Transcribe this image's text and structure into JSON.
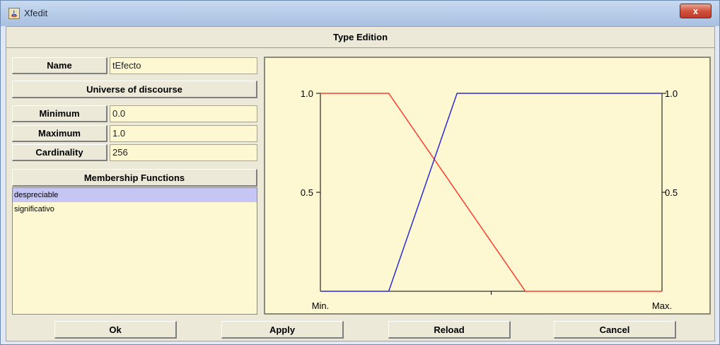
{
  "window": {
    "title": "Xfedit",
    "close_label": "x"
  },
  "header": {
    "title": "Type Edition"
  },
  "form": {
    "name_label": "Name",
    "name_value": "tEfecto",
    "universe_label": "Universe of discourse",
    "minimum_label": "Minimum",
    "minimum_value": "0.0",
    "maximum_label": "Maximum",
    "maximum_value": "1.0",
    "cardinality_label": "Cardinality",
    "cardinality_value": "256",
    "mf_label": "Membership Functions",
    "mf_items": [
      {
        "label": "despreciable",
        "selected": true
      },
      {
        "label": "significativo",
        "selected": false
      }
    ]
  },
  "plot": {
    "y_ticks": [
      "1.0",
      "0.5"
    ],
    "x_min_label": "Min.",
    "x_max_label": "Max."
  },
  "chart_data": {
    "type": "line",
    "xlim": [
      0,
      1
    ],
    "ylim": [
      0,
      1
    ],
    "yticks": [
      0.5,
      1.0
    ],
    "series": [
      {
        "color": "#ff3b30",
        "points": [
          [
            0,
            1
          ],
          [
            0.2,
            1
          ],
          [
            0.6,
            0
          ],
          [
            1,
            0
          ]
        ]
      },
      {
        "color": "#2b2bd9",
        "points": [
          [
            0,
            0
          ],
          [
            0.2,
            0
          ],
          [
            0.4,
            1
          ],
          [
            1,
            1
          ]
        ]
      }
    ]
  },
  "buttons": {
    "ok": "Ok",
    "apply": "Apply",
    "reload": "Reload",
    "cancel": "Cancel"
  }
}
